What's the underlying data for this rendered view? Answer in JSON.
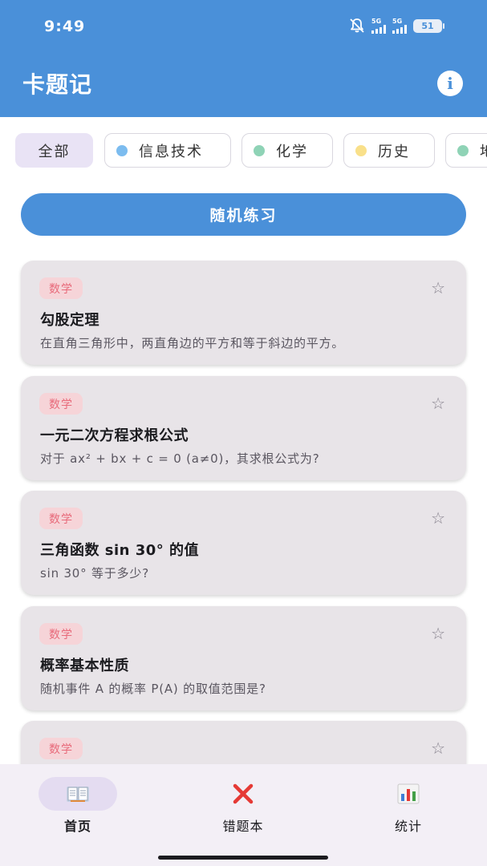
{
  "status_bar": {
    "time": "9:49",
    "sim1": "5G",
    "sim2": "5G",
    "battery": "51"
  },
  "app_bar": {
    "title": "卡题记",
    "info_icon": "info-icon"
  },
  "filters": [
    {
      "label": "全部",
      "active": true
    },
    {
      "label": "信息技术",
      "dot_color": "#7cbcef"
    },
    {
      "label": "化学",
      "dot_color": "#8fd3b6"
    },
    {
      "label": "历史",
      "dot_color": "#f9e08a"
    },
    {
      "label": "地",
      "dot_color": "#8fd3b6"
    }
  ],
  "random_button": {
    "label": "随机练习"
  },
  "cards": [
    {
      "tag": "数学",
      "title": "勾股定理",
      "desc": "在直角三角形中，两直角边的平方和等于斜边的平方。"
    },
    {
      "tag": "数学",
      "title": "一元二次方程求根公式",
      "desc": "对于 ax² + bx + c = 0 (a≠0)，其求根公式为?"
    },
    {
      "tag": "数学",
      "title": "三角函数 sin 30° 的值",
      "desc": "sin 30° 等于多少?"
    },
    {
      "tag": "数学",
      "title": "概率基本性质",
      "desc": "随机事件 A 的概率 P(A) 的取值范围是?"
    },
    {
      "tag": "数学",
      "title": "",
      "desc": ""
    }
  ],
  "bottom_nav": {
    "home": {
      "label": "首页",
      "icon": "book-icon"
    },
    "wrong": {
      "label": "错题本",
      "icon": "cross-icon"
    },
    "stats": {
      "label": "统计",
      "icon": "bar-chart-icon"
    }
  },
  "colors": {
    "primary": "#4a90d9",
    "tag_bg": "#f6d4d8",
    "tag_text": "#e86a7a",
    "card_bg": "#e8e4e8"
  }
}
